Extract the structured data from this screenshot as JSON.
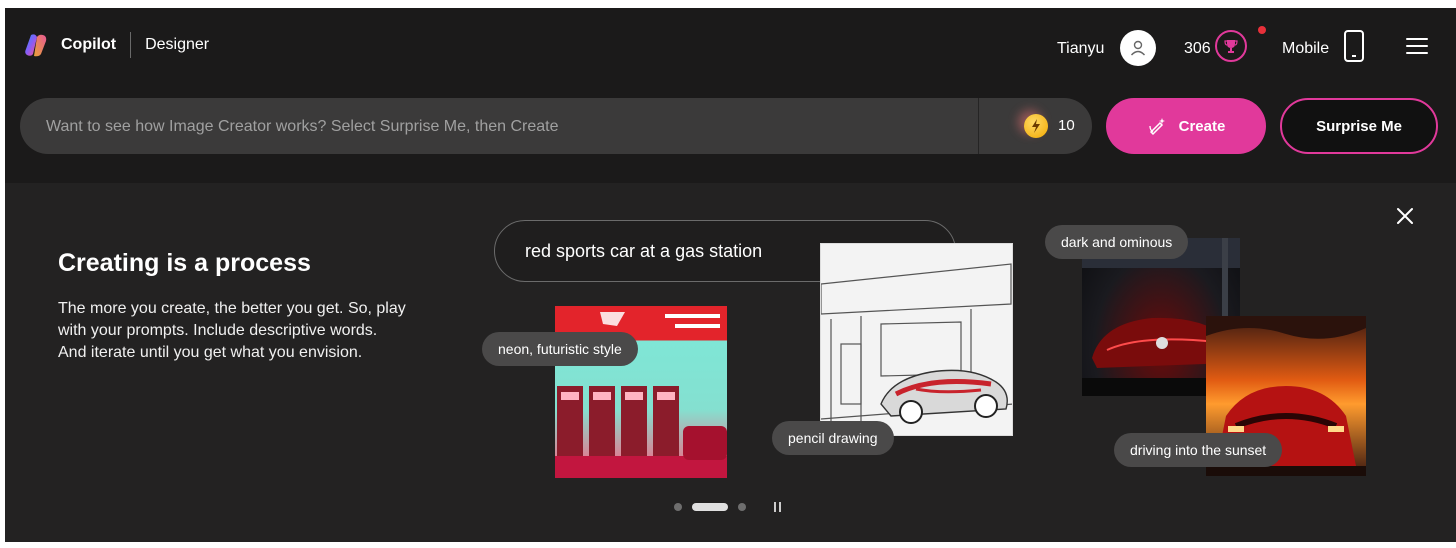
{
  "header": {
    "brand": "Copilot",
    "product": "Designer",
    "user_name": "Tianyu",
    "points": "306",
    "mobile_label": "Mobile"
  },
  "search": {
    "placeholder": "Want to see how Image Creator works? Select Surprise Me, then Create",
    "boosts": "10"
  },
  "buttons": {
    "create": "Create",
    "surprise": "Surprise Me"
  },
  "panel": {
    "heading": "Creating is a process",
    "description": "The more you create, the better you get. So, play with your prompts. Include descriptive words. And iterate until you get what you envision.",
    "prompt": "red sports car at a gas station",
    "tags": {
      "neon": "neon, futuristic style",
      "pencil": "pencil drawing",
      "dark": "dark and ominous",
      "sunset": "driving into the sunset"
    },
    "carousel": {
      "slides": 3,
      "active_index": 1
    }
  },
  "colors": {
    "accent": "#e1399b",
    "background": "#1b1a1a",
    "panel": "#232222",
    "search_bg": "#3b3a3a",
    "notification_dot": "#e8303a"
  },
  "icons": [
    "copilot-logo-icon",
    "user-icon",
    "trophy-icon",
    "mobile-icon",
    "menu-icon",
    "boost-icon",
    "create-pen-icon",
    "close-icon",
    "pause-icon"
  ]
}
